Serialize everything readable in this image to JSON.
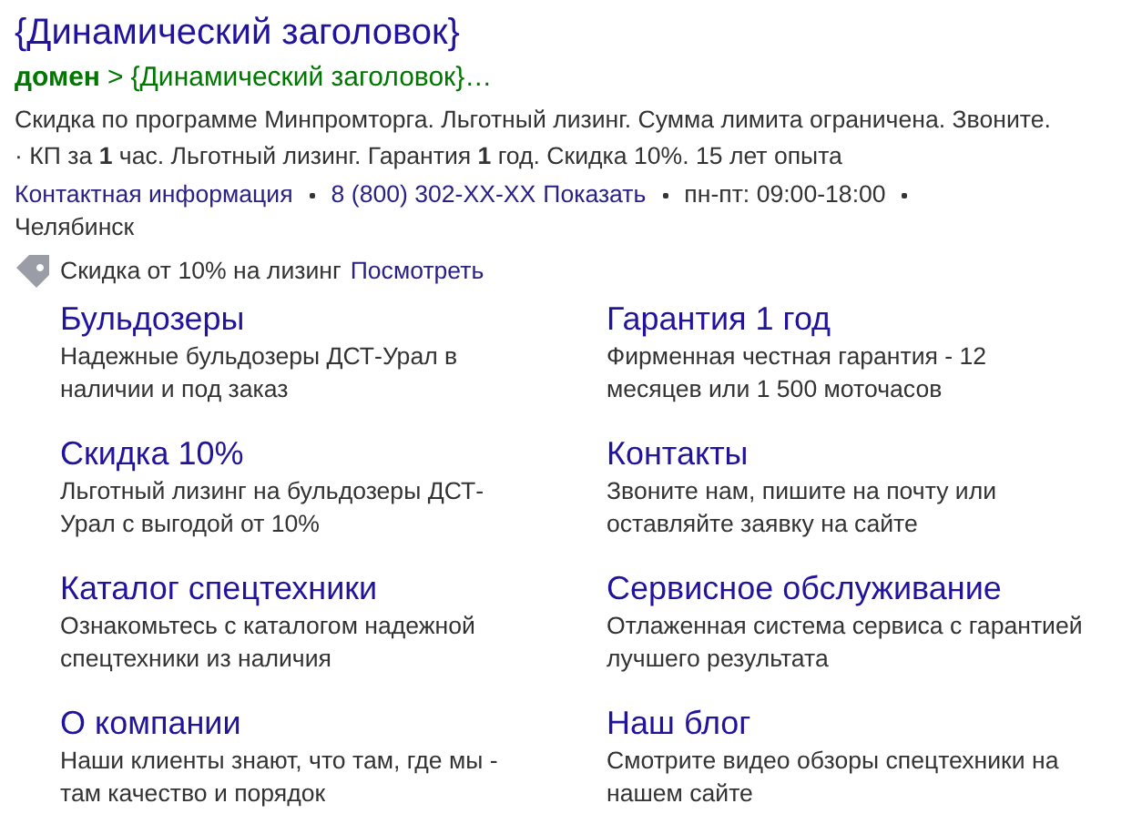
{
  "title": "{Динамический заголовок}",
  "breadcrumb": {
    "domain": "домен",
    "separator": ">",
    "path": "{Динамический заголовок}…"
  },
  "description": "Скидка по программе Минпромторга. Льготный лизинг. Сумма лимита ограничена. Звоните. · КП за **1** час. Льготный лизинг. Гарантия **1** год. Скидка 10%. 15 лет опыта",
  "contacts": [
    {
      "kind": "link",
      "text": "Контактная информация"
    },
    {
      "kind": "phone",
      "text": "8 (800) 302-XX-XX",
      "action": "Показать"
    },
    {
      "kind": "text",
      "text": "пн-пт: 09:00-18:00"
    },
    {
      "kind": "text",
      "text": "Челябинск"
    }
  ],
  "promo": {
    "text": "Скидка от 10% на лизинг",
    "link": "Посмотреть"
  },
  "sitelinks": [
    {
      "title": "Бульдозеры",
      "description": "Надежные бульдозеры ДСТ-Урал в наличии и под заказ"
    },
    {
      "title": "Гарантия 1 год",
      "description": "Фирменная честная гарантия - 12 месяцев или 1 500 моточасов"
    },
    {
      "title": "Скидка 10%",
      "description": "Льготный лизинг на бульдозеры ДСТ-Урал с выгодой от 10%"
    },
    {
      "title": "Контакты",
      "description": "Звоните нам, пишите на почту или оставляйте заявку на сайте"
    },
    {
      "title": "Каталог спецтехники",
      "description": "Ознакомьтесь с каталогом надежной спецтехники из наличия"
    },
    {
      "title": "Сервисное обслуживание",
      "description": "Отлаженная система сервиса с гарантией лучшего результата"
    },
    {
      "title": "О компании",
      "description": "Наши клиенты знают, что там, где мы - там качество и порядок"
    },
    {
      "title": "Наш блог",
      "description": "Смотрите видео обзоры спецтехники на нашем сайте"
    }
  ]
}
